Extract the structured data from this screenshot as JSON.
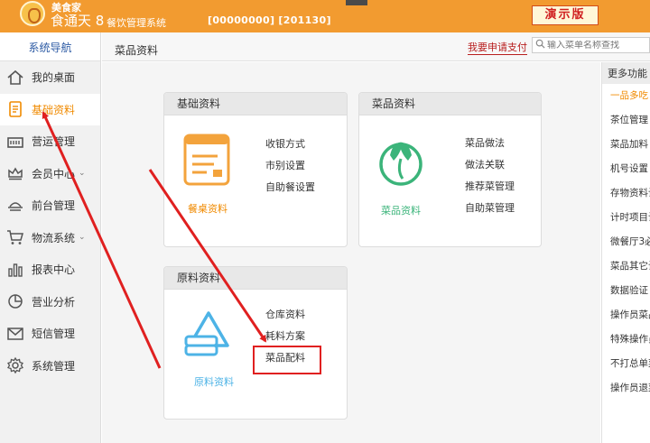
{
  "header": {
    "brand_top": "美食家",
    "brand_main": "食通天 8",
    "brand_sub": "餐饮管理系统",
    "account_info": "[00000000]  [201130]",
    "demo_badge": "演示版"
  },
  "sidebar": {
    "title": "系统导航",
    "items": [
      {
        "label": "我的桌面",
        "icon": "home-icon"
      },
      {
        "label": "基础资料",
        "icon": "document-icon",
        "active": true
      },
      {
        "label": "营运管理",
        "icon": "register-icon"
      },
      {
        "label": "会员中心",
        "icon": "crown-icon",
        "has_submenu": true
      },
      {
        "label": "前台管理",
        "icon": "counter-icon"
      },
      {
        "label": "物流系统",
        "icon": "cart-icon",
        "has_submenu": true
      },
      {
        "label": "报表中心",
        "icon": "bar-chart-icon"
      },
      {
        "label": "营业分析",
        "icon": "pie-chart-icon"
      },
      {
        "label": "短信管理",
        "icon": "mail-icon"
      },
      {
        "label": "系统管理",
        "icon": "gear-icon"
      }
    ]
  },
  "topbar": {
    "page_title": "菜品资料",
    "apply_link": "我要申请支付",
    "search_placeholder": "输入菜单名称查找"
  },
  "cards": {
    "basic": {
      "title": "基础资料",
      "icon_label": "餐桌资料",
      "links": [
        "收银方式",
        "市别设置",
        "自助餐设置"
      ]
    },
    "dish": {
      "title": "菜品资料",
      "icon_label": "菜品资料",
      "links": [
        "菜品做法",
        "做法关联",
        "推荐菜管理",
        "自助菜管理"
      ]
    },
    "material": {
      "title": "原料资料",
      "icon_label": "原料资料",
      "links": [
        "仓库资料",
        "耗料方案",
        "菜品配料"
      ]
    }
  },
  "right_panel": {
    "title": "更多功能",
    "items": [
      "一品多吃",
      "茶位管理",
      "菜品加料",
      "机号设置",
      "存物资料设",
      "计时项目设",
      "微餐厅3必",
      "菜品其它设",
      "数据验证",
      "操作员菜品",
      "特殊操作员",
      "不打总单菜",
      "操作员退菜"
    ]
  },
  "colors": {
    "header_orange": "#f29b30",
    "active_orange": "#f08a00",
    "dish_green": "#3bb47a",
    "material_blue": "#4db3e6",
    "annotation_red": "#e02020"
  }
}
